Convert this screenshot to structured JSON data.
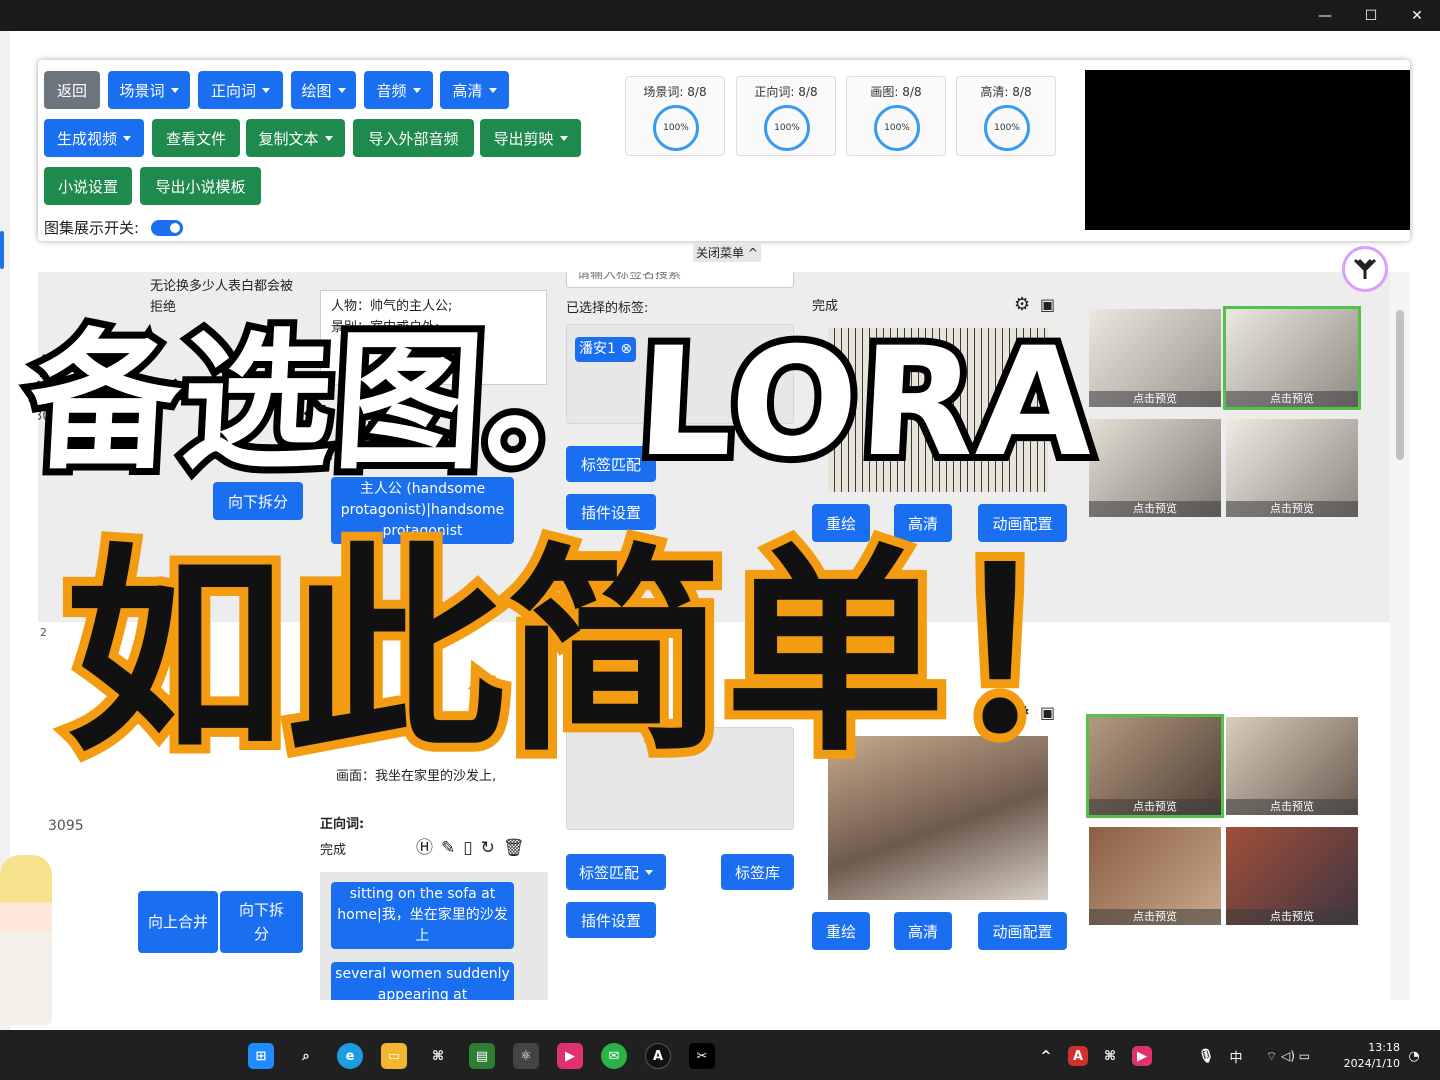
{
  "window": {
    "minimize": "—",
    "maximize": "☐",
    "close": "✕"
  },
  "menu": {
    "row1": [
      "返回",
      "场景词",
      "正向词",
      "绘图",
      "音频",
      "高清"
    ],
    "row2": [
      "生成视频",
      "查看文件",
      "复制文本",
      "导入外部音频",
      "导出剪映"
    ],
    "row3": [
      "小说设置",
      "导出小说模板"
    ],
    "toggle_label": "图集展示开关:",
    "stats": [
      {
        "label": "场景词: 8/8",
        "pct": "100%"
      },
      {
        "label": "正向词: 8/8",
        "pct": "100%"
      },
      {
        "label": "画图: 8/8",
        "pct": "100%"
      },
      {
        "label": "高清: 8/8",
        "pct": "100%"
      }
    ],
    "close_menu": "关闭菜单"
  },
  "rows": [
    {
      "index": "30",
      "original_text": "无论换多少人表白都会被拒绝",
      "split_down": "向下拆分",
      "prompt_lines": [
        "人物：帅气的主人公;",
        "景别：室内或户外;"
      ],
      "tags": [
        "主人公 (handsome protagonist)|handsome protagonist"
      ],
      "search_placeholder": "请输入标签名搜索",
      "selected_tags_label": "已选择的标签:",
      "selected_tag": "潘安1",
      "tag_match": "标签匹配",
      "plugin": "插件设置",
      "status": "完成",
      "redraw": "重绘",
      "hd": "高清",
      "anim": "动画配置",
      "preview": "点击预览"
    },
    {
      "index": "2",
      "id": "3095",
      "merge_up": "向上合并",
      "split_down": "向下拆分",
      "prompt_line": "画面：我坐在家里的沙发上,",
      "positive_label": "正向词:",
      "status": "完成",
      "tags": [
        "sitting on the sofa at home|我，坐在家里的沙发上",
        "several women suddenly appearing at"
      ],
      "tag_match": "标签匹配",
      "tag_lib": "标签库",
      "plugin": "插件设置",
      "redraw": "重绘",
      "hd": "高清",
      "anim": "动画配置",
      "preview": "点击预览"
    }
  ],
  "overlay": {
    "line1": "备选图。LORA",
    "line2": "如此简单！"
  },
  "taskbar": {
    "time": "13:18",
    "date": "2024/1/10",
    "ime": "中"
  },
  "colors": {
    "blue": "#1a6ef0",
    "green": "#1e8a4e",
    "gray": "#6c757d",
    "orange": "#f39c12"
  }
}
